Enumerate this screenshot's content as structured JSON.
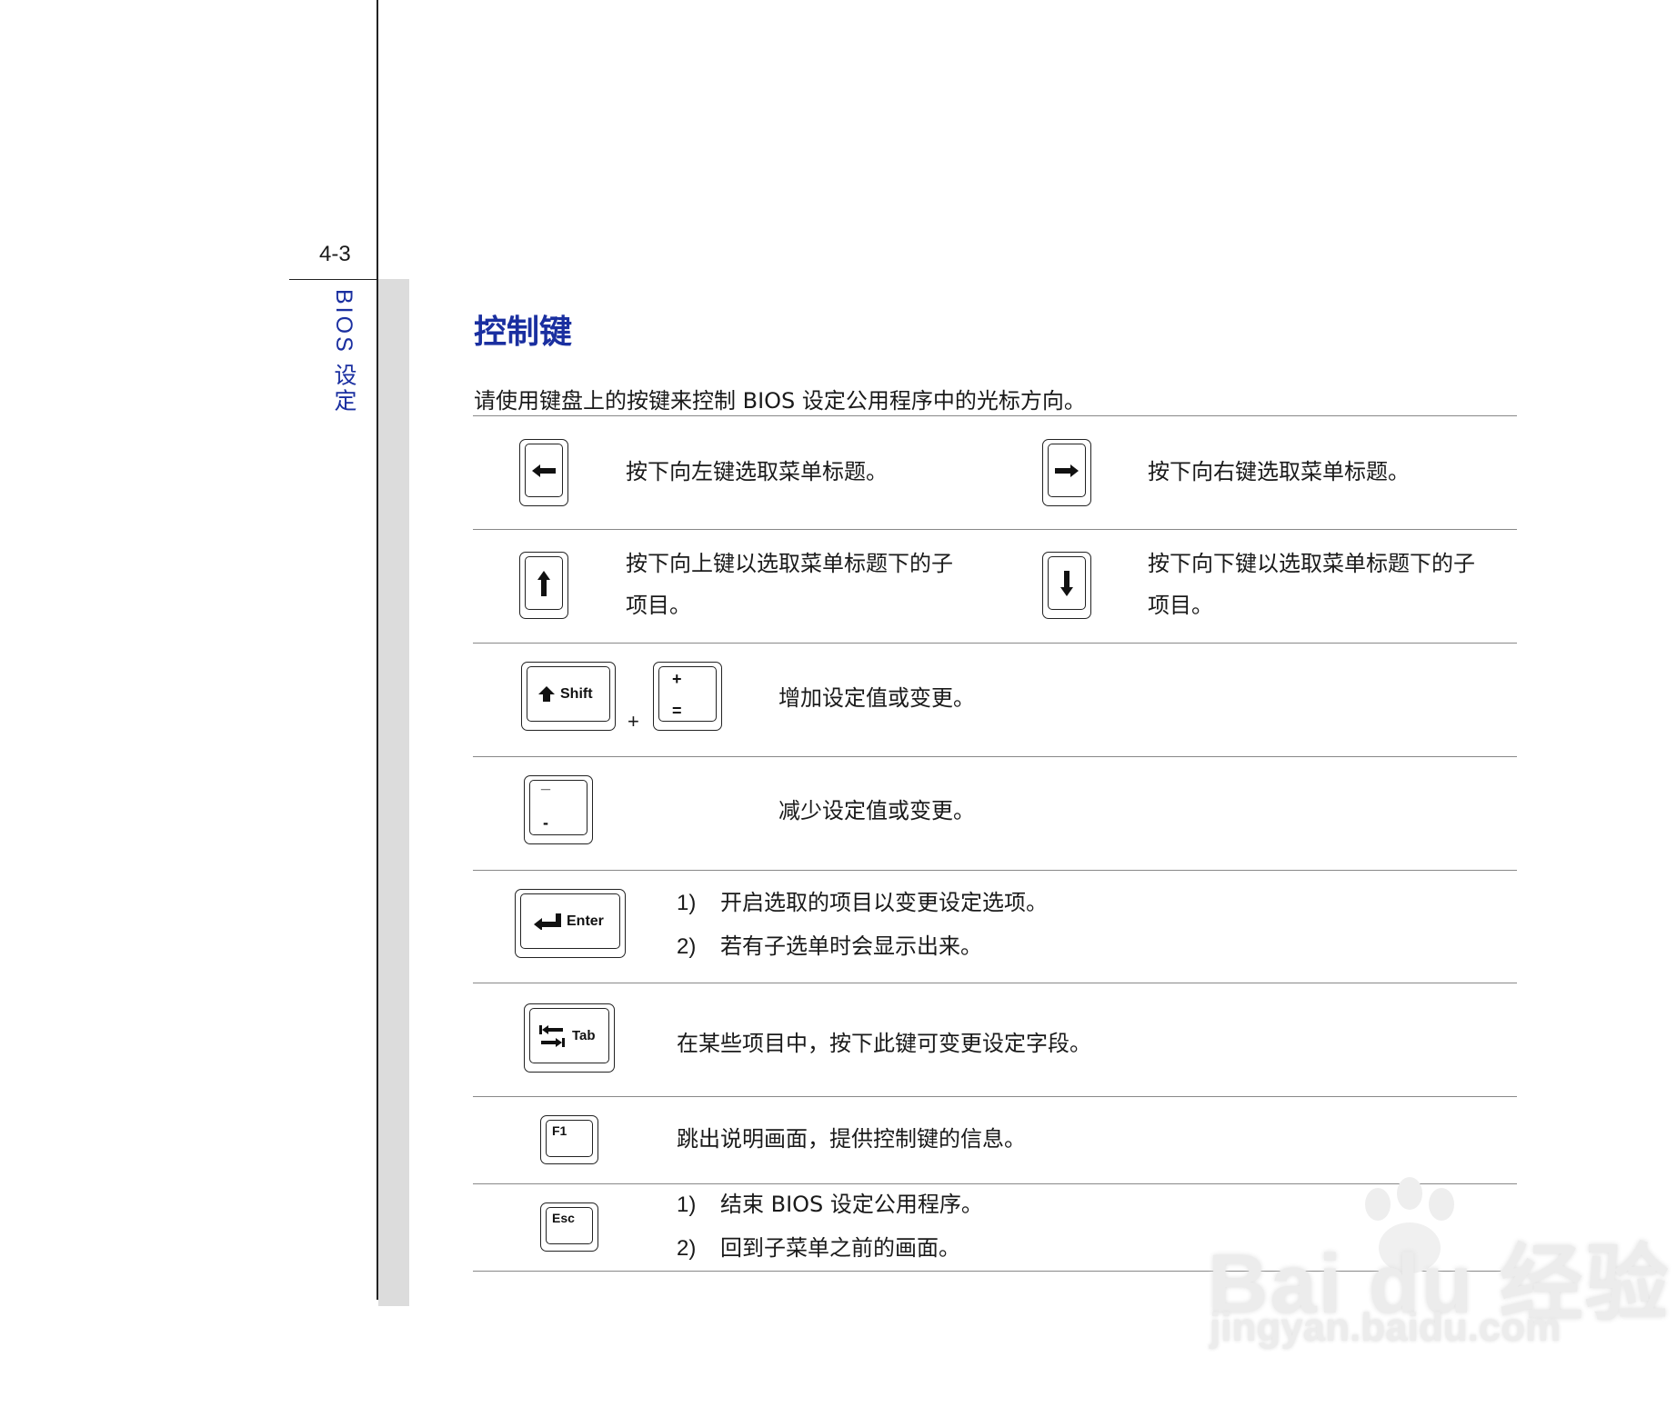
{
  "page": {
    "number": "4-3",
    "section_label": "BIOS 设定",
    "title": "控制键",
    "intro": "请使用键盘上的按键来控制 BIOS 设定公用程序中的光标方向。"
  },
  "rows": {
    "left": "按下向左键选取菜单标题。",
    "right": "按下向右键选取菜单标题。",
    "up_1": "按下向上键以选取菜单标题下的子",
    "up_2": "项目。",
    "down_1": "按下向下键以选取菜单标题下的子",
    "down_2": "项目。",
    "plus": "增加设定值或变更。",
    "minus": "减少设定值或变更。",
    "enter_1_num": "1)",
    "enter_1": "开启选取的项目以变更设定选项。",
    "enter_2_num": "2)",
    "enter_2": "若有子选单时会显示出来。",
    "tab": "在某些项目中，按下此键可变更设定字段。",
    "f1": "跳出说明画面，提供控制键的信息。",
    "esc_1_num": "1)",
    "esc_1": "结束 BIOS 设定公用程序。",
    "esc_2_num": "2)",
    "esc_2": "回到子菜单之前的画面。"
  },
  "keys": {
    "shift": "Shift",
    "plus_top": "+",
    "plus_bottom": "=",
    "plus_join": "+",
    "minus_top": "_",
    "minus_bottom": "-",
    "enter": "Enter",
    "tab": "Tab",
    "f1": "F1",
    "esc": "Esc"
  },
  "watermark": {
    "brand": "Bai du 经验",
    "url": "jingyan.baidu.com"
  },
  "colors": {
    "accent": "#1a2fa0",
    "rule": "#888888"
  }
}
